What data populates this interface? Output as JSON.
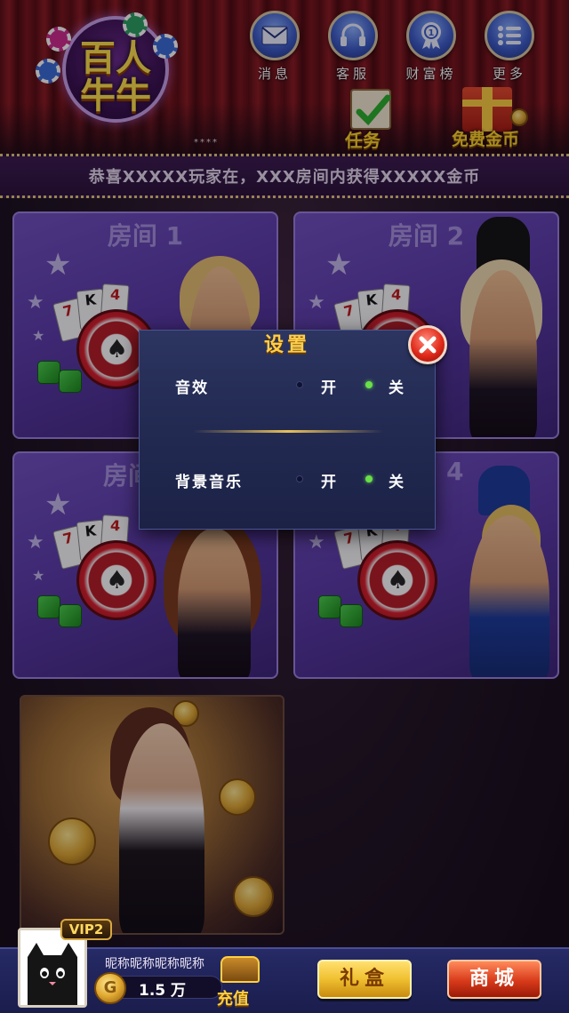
{
  "app": {
    "logo_line1": "百人",
    "logo_line2": "牛牛",
    "logo_dots": "****"
  },
  "top_nav": [
    {
      "label": "消息",
      "icon": "mail-icon"
    },
    {
      "label": "客服",
      "icon": "headset-icon"
    },
    {
      "label": "财富榜",
      "icon": "medal-icon"
    },
    {
      "label": "更多",
      "icon": "menu-list-icon"
    }
  ],
  "quick_actions": {
    "task_label": "任务",
    "free_coins_label": "免费金币"
  },
  "marquee": {
    "text": "恭喜XXXXX玩家在，XXX房间内获得XXXXX金币"
  },
  "rooms": [
    {
      "title": "房间 1"
    },
    {
      "title": "房间 2"
    },
    {
      "title": "房间"
    },
    {
      "title": "4"
    }
  ],
  "card_ranks": [
    "7",
    "K",
    "4"
  ],
  "settings_modal": {
    "title": "设置",
    "rows": [
      {
        "label": "音效",
        "on_label": "开",
        "off_label": "关",
        "selected": "off"
      },
      {
        "label": "背景音乐",
        "on_label": "开",
        "off_label": "关",
        "selected": "off"
      }
    ]
  },
  "player": {
    "vip_label": "VIP2",
    "nickname": "昵称昵称昵称昵称",
    "coin_symbol": "G",
    "coins": "1.5 万",
    "recharge_label": "充值"
  },
  "bottom_buttons": {
    "gift_label": "礼盒",
    "shop_label": "商城"
  },
  "colors": {
    "accent_gold": "#ffcf4a",
    "radio_selected": "#6adf4a",
    "radio_unselected": "#0e1230",
    "gift_button": "#f0c030",
    "shop_button": "#d83a1a"
  }
}
